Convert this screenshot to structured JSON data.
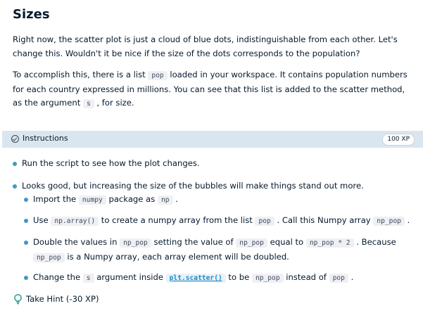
{
  "exercise": {
    "title": "Sizes",
    "intro_1": "Right now, the scatter plot is just a cloud of blue dots, indistinguishable from each other. Let's change this. Wouldn't it be nice if the size of the dots corresponds to the population?",
    "intro_2_a": "To accomplish this, there is a list ",
    "intro_2_code_pop": "pop",
    "intro_2_b": " loaded in your workspace. It contains population numbers for each country expressed in millions. You can see that this list is added to the scatter method, as the argument ",
    "intro_2_code_s": "s",
    "intro_2_c": " , for size."
  },
  "instructions": {
    "label": "Instructions",
    "xp": "100 XP",
    "items": {
      "run": "Run the script to see how the plot changes.",
      "looks_good": "Looks good, but increasing the size of the bubbles will make things stand out more.",
      "import_a": "Import the ",
      "import_code_numpy": "numpy",
      "import_b": " package as ",
      "import_code_np": "np",
      "import_c": " .",
      "use_a": "Use ",
      "use_code_array": "np.array()",
      "use_b": " to create a numpy array from the list ",
      "use_code_pop": "pop",
      "use_c": " . Call this Numpy array ",
      "use_code_np_pop": "np_pop",
      "use_d": " .",
      "double_a": "Double the values in ",
      "double_code_np_pop": "np_pop",
      "double_b": " setting the value of ",
      "double_code_np_pop_2": "np_pop",
      "double_c": " equal to ",
      "double_code_expr": "np_pop * 2",
      "double_d": " . Because ",
      "double_code_np_pop_3": "np_pop",
      "double_e": " is a Numpy array, each array element will be doubled.",
      "change_a": "Change the ",
      "change_code_s": "s",
      "change_b": " argument inside ",
      "change_code_scatter": "plt.scatter()",
      "change_c": " to be ",
      "change_code_np_pop": "np_pop",
      "change_d": " instead of ",
      "change_code_pop": "pop",
      "change_e": " ."
    }
  },
  "hint": {
    "label": "Take Hint (-30 XP)",
    "icon": "lightbulb-icon"
  },
  "colors": {
    "bullet": "#3d99c8",
    "instructions_bar": "#d9e6ef",
    "text": "#05192d",
    "link_code": "#1a8ac7"
  }
}
